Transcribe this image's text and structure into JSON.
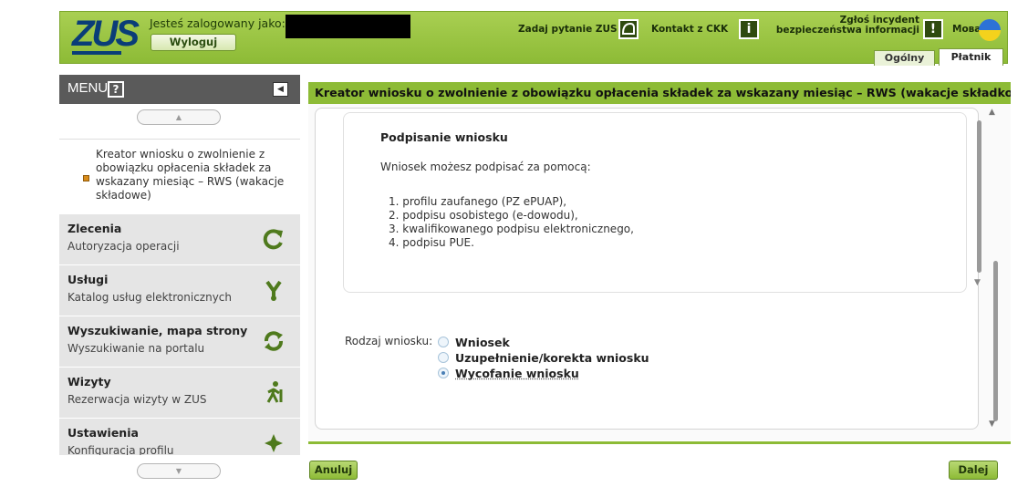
{
  "header": {
    "logo_text": "ZUS",
    "logged_in_label": "Jesteś zalogowany jako:",
    "logout_label": "Wyloguj",
    "ask_zus_label": "Zadaj pytanie ZUS",
    "ckk_label": "Kontakt z CKK",
    "incident_line1": "Zgłoś incydent",
    "incident_line2": "bezpieczeństwa informacji",
    "incident_icon": "!",
    "language_label": "Мова",
    "tabs": [
      {
        "label": "Ogólny"
      },
      {
        "label": "Płatnik"
      }
    ]
  },
  "sidebar": {
    "menu_title": "MENU",
    "help_icon": "?",
    "current_item": "Kreator wniosku o zwolnienie z obowiązku opłacenia składek za wskazany miesiąc – RWS (wakacje składowe)",
    "items": [
      {
        "title": "Zlecenia",
        "subtitle": "Autoryzacja operacji",
        "icon": "refresh-icon"
      },
      {
        "title": "Usługi",
        "subtitle": "Katalog usług elektronicznych",
        "icon": "services-icon"
      },
      {
        "title": "Wyszukiwanie, mapa strony",
        "subtitle": "Wyszukiwanie na portalu",
        "icon": "search-sync-icon"
      },
      {
        "title": "Wizyty",
        "subtitle": "Rezerwacja wizyty w ZUS",
        "icon": "walking-person-icon"
      },
      {
        "title": "Ustawienia",
        "subtitle": "Konfiguracja profilu",
        "icon": "puzzle-icon"
      }
    ]
  },
  "main": {
    "title": "Kreator wniosku o zwolnienie z obowiązku opłacenia składek za wskazany miesiąc – RWS (wakacje składkowe)",
    "info": {
      "heading": "Podpisanie wniosku",
      "intro": "Wniosek możesz podpisać za pomocą:",
      "list": [
        "1. profilu zaufanego (PZ ePUAP),",
        "2. podpisu osobistego (e-dowodu),",
        "3. kwalifikowanego podpisu elektronicznego,",
        "4. podpisu PUE."
      ]
    },
    "request_kind": {
      "label": "Rodzaj wniosku:",
      "options": [
        {
          "label": "Wniosek",
          "selected": false
        },
        {
          "label": "Uzupełnienie/korekta wniosku",
          "selected": false
        },
        {
          "label": "Wycofanie wniosku",
          "selected": true
        }
      ]
    },
    "cancel_label": "Anuluj",
    "next_label": "Dalej"
  },
  "colors": {
    "brand_green": "#8dbb36",
    "logo_blue": "#0a3d78",
    "menu_gray": "#5a5a5a"
  }
}
